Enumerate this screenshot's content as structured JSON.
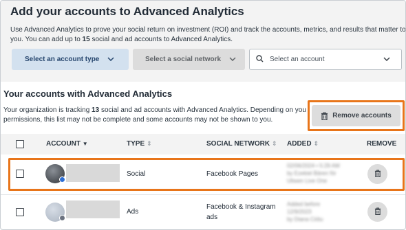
{
  "header": {
    "title": "Add your accounts to Advanced Analytics",
    "intro_line1": "Use Advanced Analytics to prove your social return on investment (ROI) and track the accounts, metrics, and results that matter to",
    "intro_line2_pre": "you. You can add up to ",
    "intro_count": "15",
    "intro_line2_post": " social and ad accounts to Advanced Analytics."
  },
  "controls": {
    "account_type_label": "Select an account type",
    "social_network_label": "Select a social network",
    "account_placeholder": "Select an account"
  },
  "section": {
    "title": "Your accounts with Advanced Analytics",
    "desc_line1_pre": "Your organization is tracking ",
    "desc_count": "13",
    "desc_line1_post": " social and ad accounts with Advanced Analytics. Depending on your",
    "desc_line2": "permissions, this list may not be complete and some accounts may not be shown to you.",
    "remove_accounts_label": "Remove accounts"
  },
  "table": {
    "headers": {
      "account": "ACCOUNT",
      "type": "TYPE",
      "social_network": "SOCIAL NETWORK",
      "added": "ADDED",
      "remove": "REMOVE"
    },
    "rows": [
      {
        "type": "Social",
        "social_network_line1": "Facebook Pages",
        "social_network_line2": "",
        "added_line1": "02/06/2024 • 5:29 AM",
        "added_line2": "by Ezekiel Bären för",
        "added_line3": "Uliwen Live One"
      },
      {
        "type": "Ads",
        "social_network_line1": "Facebook & Instagram",
        "social_network_line2": "ads",
        "added_line1": "Added before",
        "added_line2": "12/9/2023",
        "added_line3": "by Diana Ciötu"
      }
    ]
  },
  "colors": {
    "highlight": "#e8751a",
    "primary_button_bg": "#d3e1ef",
    "primary_button_text": "#25456d"
  }
}
